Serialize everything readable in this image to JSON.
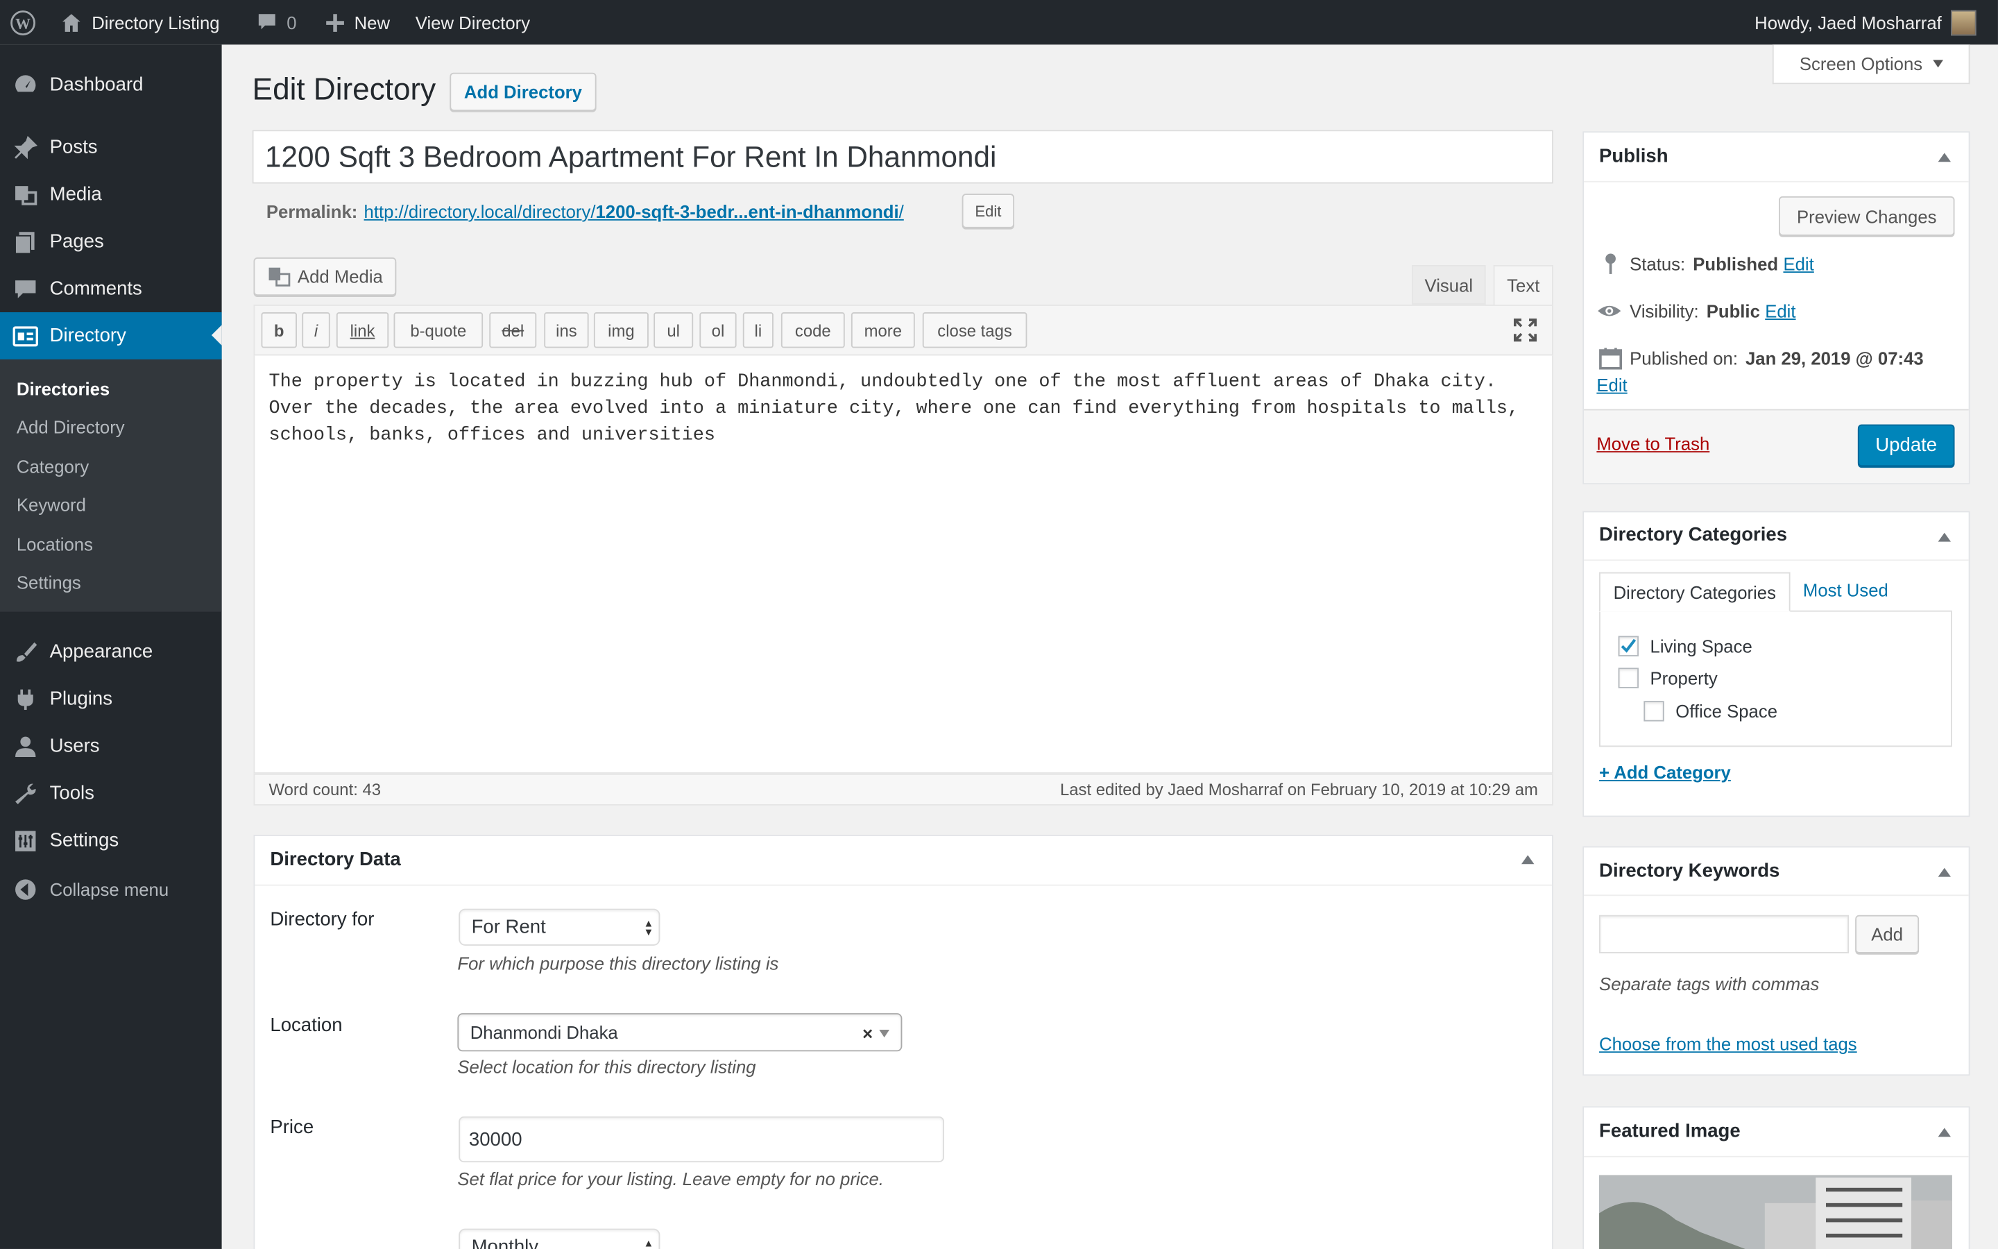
{
  "adminbar": {
    "site_name": "Directory Listing",
    "comments_count": "0",
    "new_label": "New",
    "view_label": "View Directory",
    "howdy": "Howdy, Jaed Mosharraf"
  },
  "sidebar": {
    "items": [
      {
        "label": "Dashboard",
        "icon": "dashboard-icon"
      },
      {
        "label": "Posts",
        "icon": "pin-icon"
      },
      {
        "label": "Media",
        "icon": "media-icon"
      },
      {
        "label": "Pages",
        "icon": "pages-icon"
      },
      {
        "label": "Comments",
        "icon": "comment-icon"
      },
      {
        "label": "Directory",
        "icon": "directory-icon"
      },
      {
        "label": "Appearance",
        "icon": "brush-icon"
      },
      {
        "label": "Plugins",
        "icon": "plug-icon"
      },
      {
        "label": "Users",
        "icon": "user-icon"
      },
      {
        "label": "Tools",
        "icon": "wrench-icon"
      },
      {
        "label": "Settings",
        "icon": "settings-icon"
      },
      {
        "label": "Collapse menu",
        "icon": "collapse-icon"
      }
    ],
    "submenu": [
      "Directories",
      "Add Directory",
      "Category",
      "Keyword",
      "Locations",
      "Settings"
    ]
  },
  "screen_options": "Screen Options",
  "page": {
    "heading": "Edit Directory",
    "add_new": "Add Directory",
    "title_value": "1200 Sqft 3 Bedroom Apartment For Rent In Dhanmondi",
    "permalink_label": "Permalink:",
    "permalink_base": "http://directory.local/directory/",
    "permalink_slug": "1200-sqft-3-bedr...ent-in-dhanmondi",
    "permalink_trail": "/",
    "permalink_edit": "Edit"
  },
  "editor": {
    "add_media": "Add Media",
    "tab_visual": "Visual",
    "tab_text": "Text",
    "quicktags": [
      "b",
      "i",
      "link",
      "b-quote",
      "del",
      "ins",
      "img",
      "ul",
      "ol",
      "li",
      "code",
      "more",
      "close tags"
    ],
    "content": "The property is located in buzzing hub of Dhanmondi, undoubtedly one of the most affluent areas of Dhaka city. Over the decades, the area evolved into a miniature city, where one can find everything from hospitals to malls, schools, banks, offices and universities",
    "word_count": "Word count: 43",
    "last_edited": "Last edited by Jaed Mosharraf on February 10, 2019 at 10:29 am"
  },
  "directory_data": {
    "title": "Directory Data",
    "for_label": "Directory for",
    "for_value": "For Rent",
    "for_desc": "For which purpose this directory listing is",
    "location_label": "Location",
    "location_value": "Dhanmondi Dhaka",
    "location_desc": "Select location for this directory listing",
    "price_label": "Price",
    "price_value": "30000",
    "price_desc": "Set flat price for your listing. Leave empty for no price.",
    "period_value": "Monthly"
  },
  "publish": {
    "title": "Publish",
    "preview": "Preview Changes",
    "status_label": "Status:",
    "status_value": "Published",
    "visibility_label": "Visibility:",
    "visibility_value": "Public",
    "published_label": "Published on:",
    "published_value": "Jan 29, 2019 @ 07:43",
    "edit": "Edit",
    "trash": "Move to Trash",
    "update": "Update"
  },
  "categories": {
    "title": "Directory Categories",
    "tab_all": "Directory Categories",
    "tab_used": "Most Used",
    "items": [
      {
        "label": "Living Space",
        "checked": true
      },
      {
        "label": "Property",
        "checked": false
      },
      {
        "label": "Office Space",
        "checked": false
      }
    ],
    "add": "+ Add Category"
  },
  "keywords": {
    "title": "Directory Keywords",
    "add": "Add",
    "hint": "Separate tags with commas",
    "choose": "Choose from the most used tags"
  },
  "featured": {
    "title": "Featured Image"
  },
  "colors": {
    "accent": "#0073aa",
    "sidebar": "#23282d",
    "trash": "#a00"
  }
}
